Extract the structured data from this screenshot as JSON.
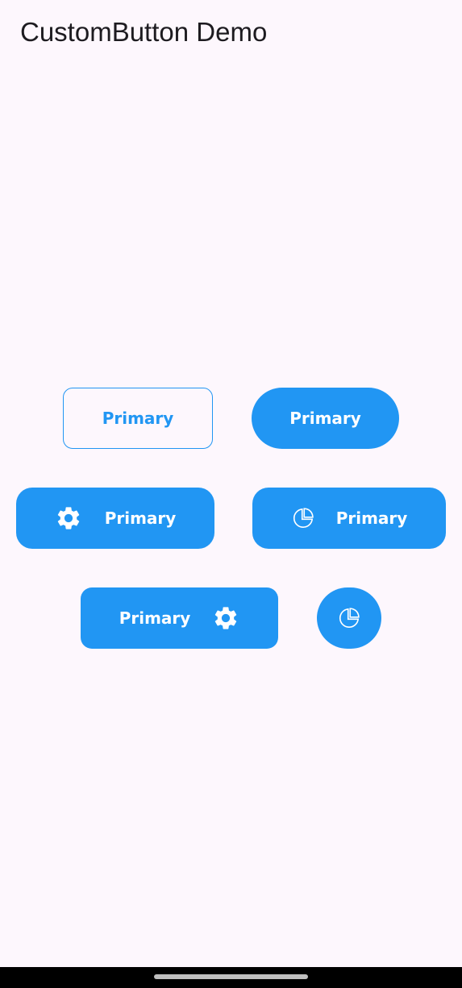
{
  "app_bar": {
    "title": "CustomButton Demo"
  },
  "buttons": {
    "outline": {
      "label": "Primary"
    },
    "pill": {
      "label": "Primary"
    },
    "gear_left": {
      "label": "Primary",
      "icon": "gear-icon"
    },
    "pie_left": {
      "label": "Primary",
      "icon": "pie-chart-icon"
    },
    "gear_right": {
      "label": "Primary",
      "icon": "gear-icon"
    },
    "icon_only": {
      "icon": "pie-chart-icon"
    }
  },
  "colors": {
    "accent": "#2196F3",
    "background": "#FDF7FD",
    "on_accent": "#FFFFFF"
  }
}
